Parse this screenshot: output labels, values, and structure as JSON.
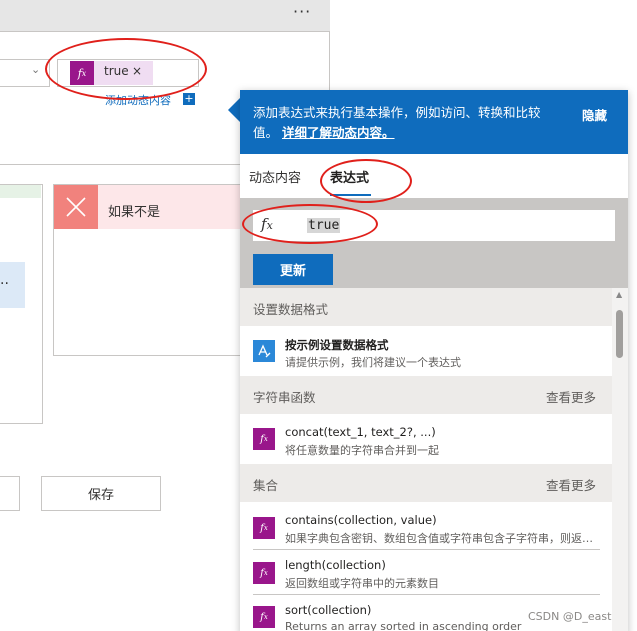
{
  "background": {
    "more_label": "···",
    "token_text": "true",
    "token_close": "×",
    "token_icon": "fx-icon",
    "add_dynamic": "添加动态内容",
    "add_dynamic_plus": "+",
    "else_label": "如果不是",
    "save_label": "保存",
    "left_dots": "··"
  },
  "flyout": {
    "info_text": "添加表达式来执行基本操作，例如访问、转换和比较值。",
    "info_link": "详细了解动态内容。",
    "hide_label": "隐藏",
    "tabs": [
      {
        "label": "动态内容",
        "active": false
      },
      {
        "label": "表达式",
        "active": true
      }
    ],
    "expression_value": "true",
    "fx_label": "fx",
    "update_label": "更新",
    "sections": [
      {
        "title": "设置数据格式",
        "more": "",
        "items": [
          {
            "icon": "format-icon",
            "name": "按示例设置数据格式",
            "desc": "请提供示例，我们将建议一个表达式"
          }
        ]
      },
      {
        "title": "字符串函数",
        "more": "查看更多",
        "items": [
          {
            "icon": "fx-icon",
            "name": "concat(text_1, text_2?, ...)",
            "desc": "将任意数量的字符串合并到一起"
          }
        ]
      },
      {
        "title": "集合",
        "more": "查看更多",
        "items": [
          {
            "icon": "fx-icon",
            "name": "contains(collection, value)",
            "desc": "如果字典包含密钥、数组包含值或字符串包含子字符串，则返回 true"
          },
          {
            "icon": "fx-icon",
            "name": "length(collection)",
            "desc": "返回数组或字符串中的元素数目"
          },
          {
            "icon": "fx-icon",
            "name": "sort(collection)",
            "desc": "Returns an array sorted in ascending order"
          }
        ]
      }
    ]
  },
  "watermark": "CSDN @D_east",
  "colors": {
    "accent": "#0f6cbd",
    "function_icon": "#99168b",
    "annotation": "#e0201b",
    "else_header": "#fde7e9",
    "else_icon": "#f1827d"
  }
}
